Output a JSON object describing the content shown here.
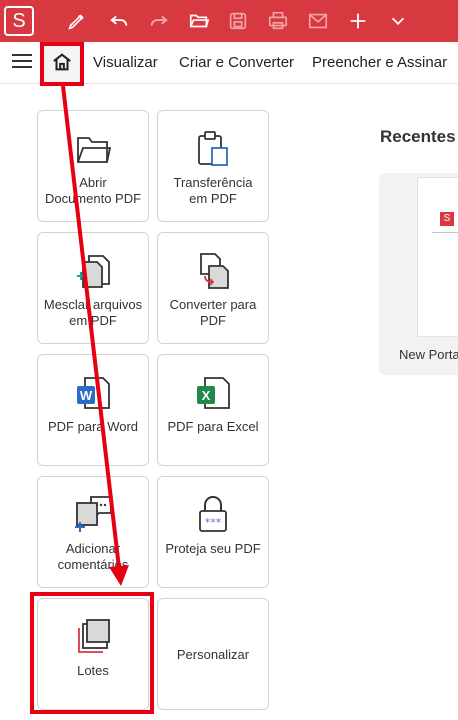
{
  "app": {
    "logo_letter": "S"
  },
  "toolbar": {
    "icons": [
      "pen-icon",
      "undo-icon",
      "redo-icon",
      "open-folder-icon",
      "save-icon",
      "print-icon",
      "email-icon",
      "plus-icon",
      "chevron-down-icon"
    ]
  },
  "menu": {
    "items": [
      "Visualizar",
      "Criar e Converter",
      "Preencher e Assinar"
    ]
  },
  "tools": [
    {
      "label": "Abrir Documento PDF",
      "label_lines": [
        "Abrir",
        "Documento PDF"
      ]
    },
    {
      "label": "Transferência em PDF",
      "label_lines": [
        "Transferência",
        "em PDF"
      ]
    },
    {
      "label": "Mesclar arquivos em PDF",
      "label_lines": [
        "Mesclar arquivos",
        "em PDF"
      ]
    },
    {
      "label": "Converter para PDF",
      "label_lines": [
        "Converter para",
        "PDF"
      ]
    },
    {
      "label": "PDF para Word",
      "label_lines": [
        "PDF para Word"
      ]
    },
    {
      "label": "PDF para Excel",
      "label_lines": [
        "PDF para Excel"
      ]
    },
    {
      "label": "Adicionar comentários",
      "label_lines": [
        "Adicionar",
        "comentários"
      ]
    },
    {
      "label": "Proteja seu PDF",
      "label_lines": [
        "Proteja seu PDF"
      ]
    },
    {
      "label": "Lotes",
      "label_lines": [
        "Lotes"
      ]
    },
    {
      "label": "Personalizar",
      "label_lines": [
        "Personalizar"
      ]
    }
  ],
  "recent": {
    "title": "Recentes",
    "files": [
      {
        "name": "New Portal",
        "thumb_logo": "S"
      }
    ]
  },
  "colors": {
    "brand_red": "#d8383f",
    "annotation_red": "#e60012",
    "word_blue": "#2b6cc4",
    "excel_green": "#1f8a4c"
  }
}
